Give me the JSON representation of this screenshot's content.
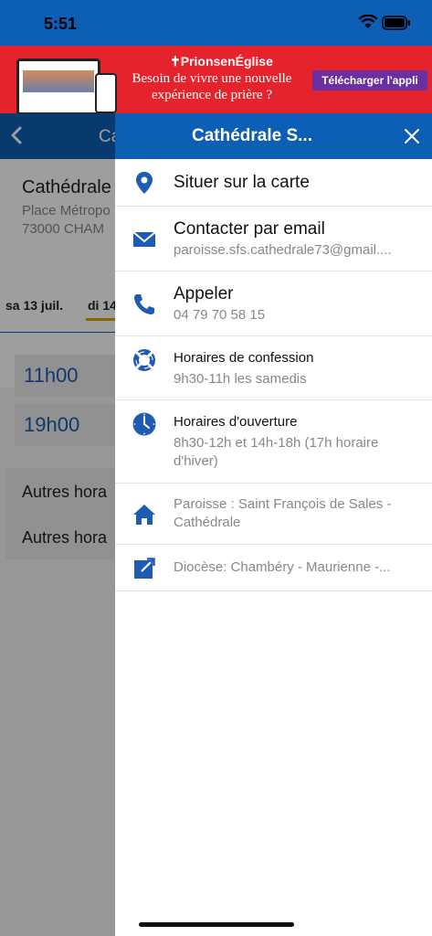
{
  "status": {
    "time": "5:51"
  },
  "banner": {
    "brand": "✝PrionsenÉglise",
    "tagline": "Besoin de vivre une nouvelle expérience de prière ?",
    "cta": "Télécharger l'appli"
  },
  "background": {
    "nav_title": "Ca",
    "church_name": "Cathédrale",
    "address_line1": "Place Métropo",
    "address_line2": "73000 CHAM",
    "day1": "sa 13 juil.",
    "day2": "di 14",
    "times": [
      "11h00",
      "19h00"
    ],
    "other1": "Autres hora",
    "other2": "Autres hora"
  },
  "drawer": {
    "title": "Cathédrale S...",
    "items": [
      {
        "title": "Situer sur la carte",
        "sub": ""
      },
      {
        "title": "Contacter par email",
        "sub": "paroisse.sfs.cathedrale73@gmail...."
      },
      {
        "title": "Appeler",
        "sub": "04 79 70 58 15"
      },
      {
        "title": "Horaires de confession",
        "sub": "9h30-11h les samedis"
      },
      {
        "title": "Horaires d'ouverture",
        "sub": "8h30-12h et 14h-18h (17h horaire d'hiver)"
      },
      {
        "title": "Paroisse : Saint François de Sales - Cathédrale",
        "sub": ""
      },
      {
        "title": "Diocèse: Chambéry - Maurienne -...",
        "sub": ""
      }
    ]
  },
  "colors": {
    "primary": "#0d5eb5",
    "banner": "#e4232c",
    "cta": "#6b2fa1"
  },
  "icons": [
    "map-pin-icon",
    "email-icon",
    "phone-icon",
    "lifebuoy-icon",
    "clock-icon",
    "home-icon",
    "external-link-icon",
    "close-icon",
    "back-chevron-icon"
  ]
}
